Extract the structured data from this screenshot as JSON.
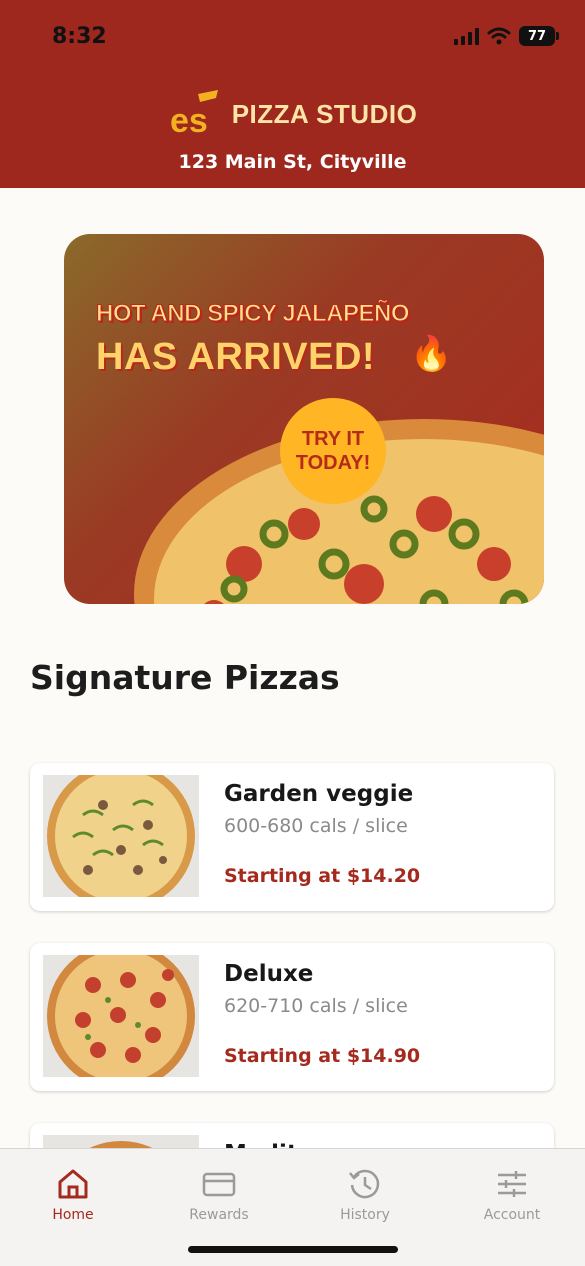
{
  "status_bar": {
    "time": "8:32",
    "battery": "77"
  },
  "header": {
    "brand_name": "PIZZA STUDIO",
    "address": "123 Main St, Cityville"
  },
  "promo": {
    "line1": "HOT AND SPICY JALAPEÑO",
    "line2": "HAS ARRIVED!",
    "badge_line1": "TRY IT",
    "badge_line2": "TODAY!"
  },
  "section": {
    "title": "Signature Pizzas"
  },
  "pizzas": [
    {
      "name": "Garden veggie",
      "cals": "600-680 cals / slice",
      "price": "Starting at $14.20"
    },
    {
      "name": "Deluxe",
      "cals": "620-710 cals / slice",
      "price": "Starting at $14.90"
    },
    {
      "name": "Medit...",
      "cals": "",
      "price": ""
    }
  ],
  "tabs": [
    {
      "label": "Home",
      "icon": "home-icon",
      "active": true
    },
    {
      "label": "Rewards",
      "icon": "card-icon",
      "active": false
    },
    {
      "label": "History",
      "icon": "history-icon",
      "active": false
    },
    {
      "label": "Account",
      "icon": "sliders-icon",
      "active": false
    }
  ],
  "colors": {
    "brand_red": "#9e271e",
    "accent_price": "#a52a1e",
    "badge_yellow": "#ffb524"
  }
}
